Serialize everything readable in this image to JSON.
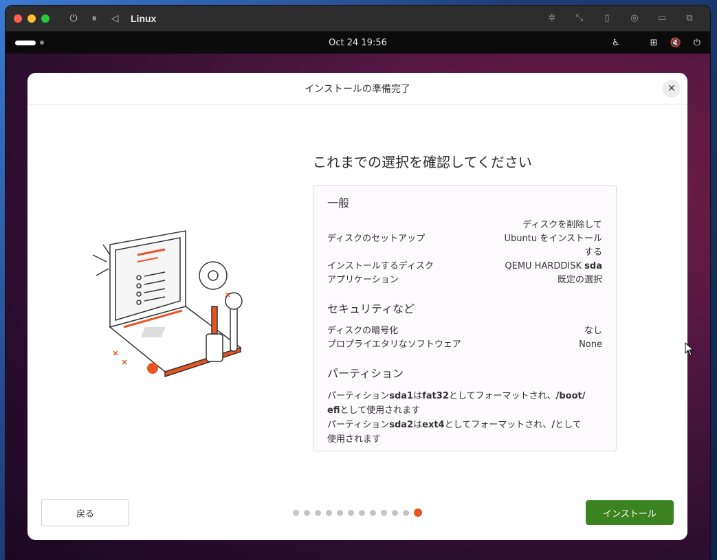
{
  "host": {
    "vm_name": "Linux",
    "controls": {
      "power_icon": "power-icon",
      "pause_icon": "pause-icon",
      "back_icon": "back-triangle-icon"
    },
    "right_icons": [
      "brightness-icon",
      "resize-icon",
      "usb-icon",
      "network-icon",
      "folder-icon",
      "windows-icon"
    ]
  },
  "topbar": {
    "clock": "Oct 24  19:56",
    "tray_icons": [
      "accessibility-icon",
      "network-icon",
      "volume-muted-icon",
      "power-icon"
    ]
  },
  "dialog": {
    "title": "インストールの準備完了",
    "heading": "これまでの選択を確認してください",
    "sections": {
      "general": {
        "title": "一般",
        "disk_setup_label": "ディスクのセットアップ",
        "disk_setup_value_1": "ディスクを削除して",
        "disk_setup_value_2": "Ubuntu をインストール",
        "disk_setup_value_3": "する",
        "install_disk_label": "インストールするディスク",
        "install_disk_value": "QEMU HARDDISK",
        "install_disk_device": "sda",
        "apps_label": "アプリケーション",
        "apps_value": "既定の選択"
      },
      "security": {
        "title": "セキュリティなど",
        "encryption_label": "ディスクの暗号化",
        "encryption_value": "なし",
        "proprietary_label": "プロプライエタリなソフトウェア",
        "proprietary_value": "None"
      },
      "partitions": {
        "title": "パーティション",
        "p1_a": "パーティション",
        "p1_dev": "sda1",
        "p1_b": "は",
        "p1_fs": "fat32",
        "p1_c": "としてフォーマットされ、",
        "p1_mount_1": "/boot/",
        "p1_mount_2": "efi",
        "p1_d": "として使用されます",
        "p2_a": "パーティション",
        "p2_dev": "sda2",
        "p2_b": "は",
        "p2_fs": "ext4",
        "p2_c": "としてフォーマットされ、",
        "p2_mount": "/",
        "p2_d": "として",
        "p2_e": "使用されます"
      }
    },
    "back_label": "戻る",
    "install_label": "インストール",
    "progress": {
      "total_steps": 12,
      "current_step": 12
    },
    "accent_color": "#e95420",
    "install_color": "#3b8221"
  }
}
